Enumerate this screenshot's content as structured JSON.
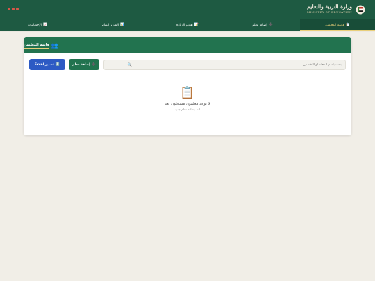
{
  "header": {
    "ministry_ar": "وزارة التربية والتعليم",
    "ministry_en": "MINISTRY OF EDUCATION",
    "logo_icon": "flag-emblem-icon"
  },
  "nav": {
    "items": [
      {
        "label": "قائمة المعلمين",
        "icon": "📋",
        "active": true
      },
      {
        "label": "إضافة معلم",
        "icon": "➕",
        "active": false
      },
      {
        "label": "تقويم الزيارة",
        "icon": "📝",
        "active": false
      },
      {
        "label": "التقرير النهائي",
        "icon": "📊",
        "active": false
      },
      {
        "label": "الإحصائيات",
        "icon": "📈",
        "active": false
      }
    ]
  },
  "card": {
    "title": "قائمة المعلمين",
    "title_icon": "👥"
  },
  "search": {
    "placeholder": "بحث باسم المعلم أو التخصص...",
    "icon": "🔍"
  },
  "buttons": {
    "add_label": "إضافة معلم",
    "add_icon": "➕",
    "export_label": "تصدير Excel",
    "export_icon": "⬇️"
  },
  "empty_state": {
    "icon": "📋",
    "title": "لا يوجد معلمون مسجلون بعد",
    "subtitle": "ابدأ بإضافة معلم جديد"
  },
  "colors": {
    "primary": "#1e5a42",
    "accent_gold": "#e9cf7a",
    "export_blue": "#2d5ac4",
    "background": "#f1eee7"
  }
}
